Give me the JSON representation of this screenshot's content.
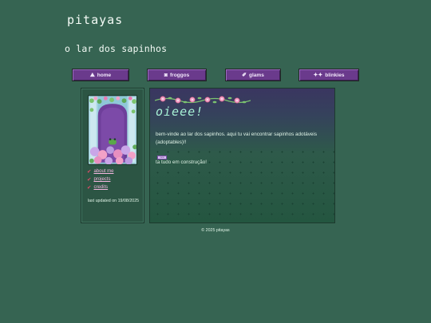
{
  "header": {
    "title": "pitayas",
    "subtitle": "o lar dos sapinhos"
  },
  "nav": [
    {
      "label": "home",
      "icon": "sun-hill-icon"
    },
    {
      "label": "froggos",
      "icon": "frog-icon"
    },
    {
      "label": "glams",
      "icon": "wand-icon"
    },
    {
      "label": "blinkies",
      "icon": "sparkle-icon"
    }
  ],
  "sidebar": {
    "links": [
      {
        "label": "about me",
        "icon": "check-icon"
      },
      {
        "label": "projects",
        "icon": "check-icon"
      },
      {
        "label": "credits",
        "icon": "check-icon"
      }
    ],
    "updated": "last updated on 19/08/2025"
  },
  "main": {
    "heading": "oieee!",
    "intro": "bem-vinde ao lar dos sapinhos. aqui tu vai encontrar sapinhos adotáveis (adoptables)!!",
    "badge": "new",
    "status": "ta tudo em construção!"
  },
  "footer": {
    "copyright": "© 2025 pitayas"
  },
  "colors": {
    "background": "#366452",
    "nav_button": "#6a3a8c",
    "link": "#f5b8e2",
    "heading": "#a6f0d4"
  }
}
